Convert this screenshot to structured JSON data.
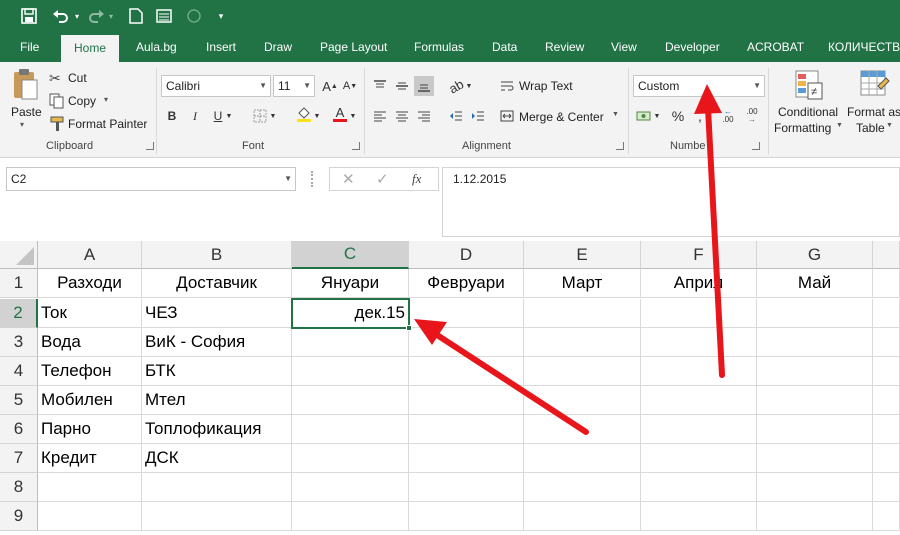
{
  "quick_access": {
    "icons": [
      "save-icon",
      "undo-icon",
      "redo-icon",
      "new-file-icon",
      "form-icon",
      "circle-icon",
      "customize-icon"
    ]
  },
  "tabs": [
    "File",
    "Home",
    "Aula.bg",
    "Insert",
    "Draw",
    "Page Layout",
    "Formulas",
    "Data",
    "Review",
    "View",
    "Developer",
    "ACROBAT",
    "КОЛИЧЕСТВ"
  ],
  "active_tab": "Home",
  "ribbon": {
    "clipboard": {
      "paste": "Paste",
      "cut": "Cut",
      "copy": "Copy",
      "format_painter": "Format Painter",
      "label": "Clipboard"
    },
    "font": {
      "name": "Calibri",
      "size": "11",
      "bold": "B",
      "italic": "I",
      "underline": "U",
      "font_color_glyph": "A",
      "label": "Font"
    },
    "alignment": {
      "wrap_text": "Wrap Text",
      "merge_center": "Merge & Center",
      "label": "Alignment"
    },
    "number": {
      "format": "Custom",
      "label": "Numbe"
    },
    "styles": {
      "conditional_1": "Conditional",
      "conditional_2": "Formatting",
      "format_as_1": "Format as",
      "format_as_2": "Table"
    }
  },
  "formula_bar": {
    "name_box": "C2",
    "cancel": "✕",
    "enter": "✓",
    "fx": "fx",
    "value": "1.12.2015"
  },
  "columns": [
    "A",
    "B",
    "C",
    "D",
    "E",
    "F",
    "G"
  ],
  "selected_column": "C",
  "rows": [
    "1",
    "2",
    "3",
    "4",
    "5",
    "6",
    "7",
    "8",
    "9"
  ],
  "selected_row": "2",
  "cells": {
    "A1": "Разходи",
    "B1": "Доставчик",
    "C1": "Януари",
    "D1": "Февруари",
    "E1": "Март",
    "F1": "Април",
    "G1": "Май",
    "A2": "Ток",
    "B2": "ЧЕЗ",
    "C2": "дек.15",
    "A3": "Вода",
    "B3": "ВиК - София",
    "A4": "Телефон",
    "B4": "БТК",
    "A5": "Мобилен",
    "B5": "Мтел",
    "A6": "Парно",
    "B6": "Топлофикация",
    "A7": "Кредит",
    "B7": "ДСК"
  },
  "colors": {
    "brand": "#217346",
    "annotation_arrow": "#e8161b"
  }
}
